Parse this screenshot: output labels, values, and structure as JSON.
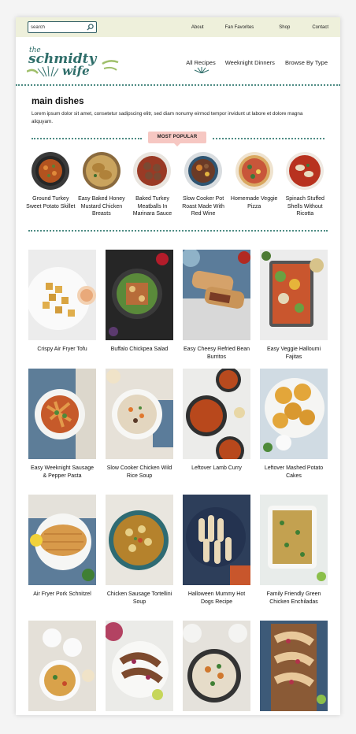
{
  "topbar": {
    "search_placeholder": "search",
    "links": [
      "About",
      "Fan Favorites",
      "Shop",
      "Contact"
    ]
  },
  "logo": {
    "line1": "the",
    "line2": "schmidty",
    "line3": "wife"
  },
  "mainnav": [
    "All Recipes",
    "Weeknight Dinners",
    "Browse By Type"
  ],
  "intro": {
    "heading": "main dishes",
    "body": "Lorem ipsum dolor sit amet, consetetur sadipscing elitr, sed diam nonumy eirmod tempor invidunt ut labore et dolore magna aliquyam."
  },
  "popular": {
    "badge": "MOST POPULAR",
    "items": [
      {
        "title": "Ground Turkey Sweet Potato Skillet"
      },
      {
        "title": "Easy Baked Honey Mustard Chicken Breasts"
      },
      {
        "title": "Baked Turkey Meatballs In Marinara Sauce"
      },
      {
        "title": "Slow Cooker Pot Roast Made With Red Wine"
      },
      {
        "title": "Homemade Veggie Pizza"
      },
      {
        "title": "Spinach Stuffed Shells Without Ricotta"
      }
    ]
  },
  "recipes": [
    {
      "title": "Crispy Air Fryer Tofu"
    },
    {
      "title": "Buffalo Chickpea Salad"
    },
    {
      "title": "Easy Cheesy Refried Bean Burritos"
    },
    {
      "title": "Easy Veggie Halloumi Fajitas"
    },
    {
      "title": "Easy Weeknight Sausage & Pepper Pasta"
    },
    {
      "title": "Slow Cooker Chicken Wild Rice Soup"
    },
    {
      "title": "Leftover Lamb Curry"
    },
    {
      "title": "Leftover Mashed Potato Cakes"
    },
    {
      "title": "Air Fryer Pork Schnitzel"
    },
    {
      "title": "Chicken Sausage Tortellini Soup"
    },
    {
      "title": "Halloween Mummy Hot Dogs Recipe"
    },
    {
      "title": "Family Friendly Green Chicken Enchiladas"
    },
    {
      "title": ""
    },
    {
      "title": ""
    },
    {
      "title": ""
    },
    {
      "title": ""
    }
  ],
  "colors": {
    "topbar_bg": "#eef0db",
    "accent_teal": "#2f6e6a",
    "badge_pink": "#f6c7c2",
    "dotted_rule": "#4e8c84"
  }
}
